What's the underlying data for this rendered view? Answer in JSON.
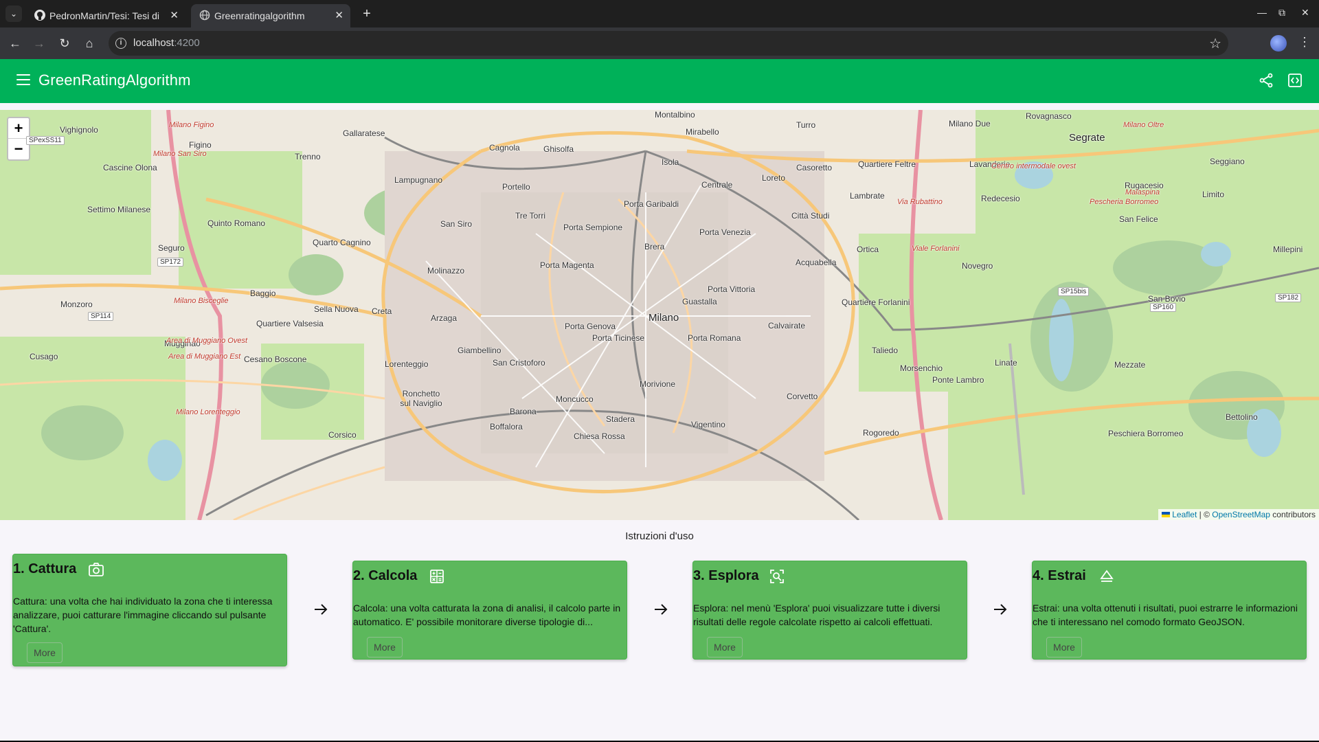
{
  "browser": {
    "tabs": [
      {
        "title": "PedronMartin/Tesi: Tesi di la",
        "active": false
      },
      {
        "title": "Greenratingalgorithm",
        "active": true
      }
    ],
    "url_host": "localhost",
    "url_port": ":4200"
  },
  "app": {
    "title": "GreenRatingAlgorithm",
    "header_color": "#00b159"
  },
  "map": {
    "zoom_in": "+",
    "zoom_out": "−",
    "attribution": {
      "leaflet": "Leaflet",
      "separator": " | © ",
      "osm": "OpenStreetMap",
      "suffix": " contributors"
    },
    "labels": [
      {
        "text": "Milano",
        "big": true
      },
      {
        "text": "Montalbino"
      },
      {
        "text": "Mirabello"
      },
      {
        "text": "Turro"
      },
      {
        "text": "Milano Due"
      },
      {
        "text": "Rovagnasco"
      },
      {
        "text": "Segrate"
      },
      {
        "text": "Vighignolo"
      },
      {
        "text": "Gallaratese"
      },
      {
        "text": "Cagnola"
      },
      {
        "text": "Ghisolfa"
      },
      {
        "text": "Isola"
      },
      {
        "text": "Centrale"
      },
      {
        "text": "Loreto"
      },
      {
        "text": "Casoretto"
      },
      {
        "text": "Quartiere Feltre"
      },
      {
        "text": "Lavanderie"
      },
      {
        "text": "Figino"
      },
      {
        "text": "Trenno"
      },
      {
        "text": "Cascine Olona"
      },
      {
        "text": "Lampugnano"
      },
      {
        "text": "Portello"
      },
      {
        "text": "Porta Garibaldi"
      },
      {
        "text": "Lambrate"
      },
      {
        "text": "Redecesio"
      },
      {
        "text": "Rugacesio"
      },
      {
        "text": "Limito"
      },
      {
        "text": "Settimo Milanese"
      },
      {
        "text": "Quinto Romano"
      },
      {
        "text": "San Siro"
      },
      {
        "text": "Tre Torri"
      },
      {
        "text": "Porta Sempione"
      },
      {
        "text": "Città Studi"
      },
      {
        "text": "Quarto Cagnino"
      },
      {
        "text": "Brera"
      },
      {
        "text": "Porta Venezia"
      },
      {
        "text": "Ortica"
      },
      {
        "text": "Seguro"
      },
      {
        "text": "Porta Magenta"
      },
      {
        "text": "Acquabella"
      },
      {
        "text": "Novegro"
      },
      {
        "text": "Molinazzo"
      },
      {
        "text": "Porta Vittoria"
      },
      {
        "text": "Baggio"
      },
      {
        "text": "Guastalla"
      },
      {
        "text": "Quartiere Forlanini"
      },
      {
        "text": "Monzoro"
      },
      {
        "text": "Sella Nuova"
      },
      {
        "text": "Creta"
      },
      {
        "text": "Quartiere Valsesia"
      },
      {
        "text": "Arzaga"
      },
      {
        "text": "Porta Genova"
      },
      {
        "text": "Calvairate"
      },
      {
        "text": "San Bovio"
      },
      {
        "text": "Mugginao"
      },
      {
        "text": "Porta Ticinese"
      },
      {
        "text": "Porta Romana"
      },
      {
        "text": "Taliedo"
      },
      {
        "text": "Giambellino"
      },
      {
        "text": "Cusago"
      },
      {
        "text": "Cesano Boscone"
      },
      {
        "text": "Lorenteggio"
      },
      {
        "text": "San Cristoforo"
      },
      {
        "text": "Linate"
      },
      {
        "text": "Mezzate"
      },
      {
        "text": "Morsenchio"
      },
      {
        "text": "Ronchetto sul Naviglio"
      },
      {
        "text": "Morivione"
      },
      {
        "text": "Ponte Lambro"
      },
      {
        "text": "Moncucco"
      },
      {
        "text": "Corvetto"
      },
      {
        "text": "Barona"
      },
      {
        "text": "Stadera"
      },
      {
        "text": "Corsico"
      },
      {
        "text": "Boffalora"
      },
      {
        "text": "Vigentino"
      },
      {
        "text": "Chiesa Rossa"
      },
      {
        "text": "Rogoredo"
      },
      {
        "text": "Peschiera Borromeo"
      },
      {
        "text": "Bettolino"
      },
      {
        "text": "San Felice"
      },
      {
        "text": "Seggiano"
      },
      {
        "text": "Millepini"
      }
    ],
    "road_labels": [
      "SPexSS11",
      "SP172",
      "SP114",
      "SP15bis",
      "SP160",
      "SP182"
    ],
    "red_labels": [
      "Milano Figino",
      "Milano San Siro",
      "Milano Bisceglie",
      "Area di Muggiano Ovest",
      "Area di Muggiano Est",
      "Milano Lorenteggio",
      "Centro intermodale ovest",
      "Via Rubattino",
      "Viale Forlanini",
      "Pescheria Borromeo",
      "Milano Oltre",
      "Malaspina"
    ]
  },
  "instructions": {
    "title": "Istruzioni d'uso",
    "steps": [
      {
        "title": "1. Cattura",
        "icon": "camera-icon",
        "text": "Cattura: una volta che hai individuato la zona che ti interessa analizzare, puoi catturare l'immagine cliccando sul pulsante 'Cattura'.",
        "more": "More"
      },
      {
        "title": "2. Calcola",
        "icon": "calculator-icon",
        "text": "Calcola: una volta catturata la zona di analisi, il calcolo parte in automatico. E' possibile monitorare diverse tipologie di...",
        "more": "More"
      },
      {
        "title": "3. Esplora",
        "icon": "explore-icon",
        "text": "Esplora: nel menù 'Esplora' puoi visualizzare tutte i diversi risultati delle regole calcolate rispetto ai calcoli effettuati.",
        "more": "More"
      },
      {
        "title": "4. Estrai",
        "icon": "eject-icon",
        "text": "Estrai: una volta ottenuti i risultati, puoi estrarre le informazioni che ti interessano nel comodo formato GeoJSON.",
        "more": "More"
      }
    ]
  }
}
